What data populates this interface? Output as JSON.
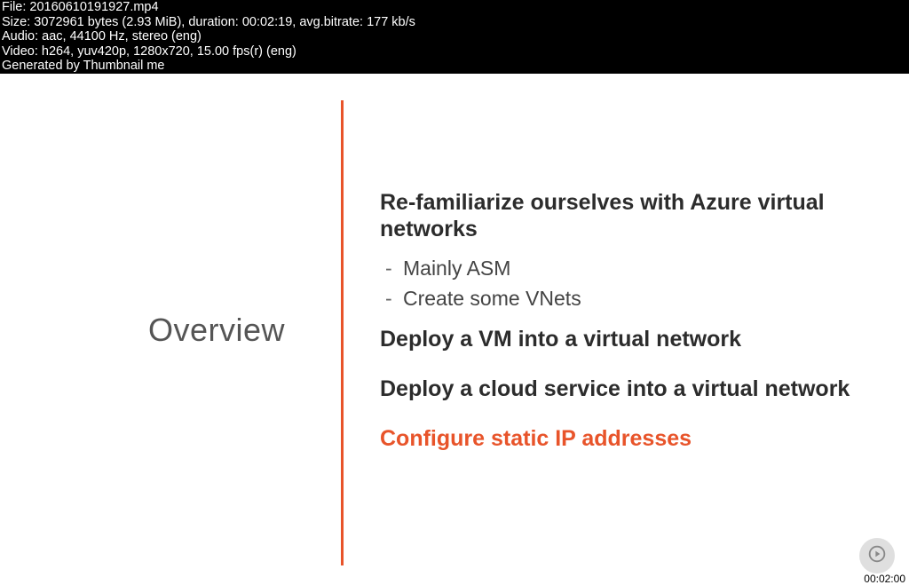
{
  "info": {
    "file": "File: 20160610191927.mp4",
    "size": "Size: 3072961 bytes (2.93 MiB), duration: 00:02:19, avg.bitrate: 177 kb/s",
    "audio": "Audio: aac, 44100 Hz, stereo (eng)",
    "video": "Video: h264, yuv420p, 1280x720, 15.00 fps(r) (eng)",
    "gen": "Generated by Thumbnail me"
  },
  "slide": {
    "left_heading": "Overview",
    "b1": "Re-familiarize ourselves with Azure virtual networks",
    "b1_sub1": "Mainly ASM",
    "b1_sub2": "Create some VNets",
    "b2": "Deploy a VM into a virtual network",
    "b3": "Deploy a cloud service into a virtual network",
    "b4": "Configure static IP addresses"
  },
  "timestamp": "00:02:00"
}
